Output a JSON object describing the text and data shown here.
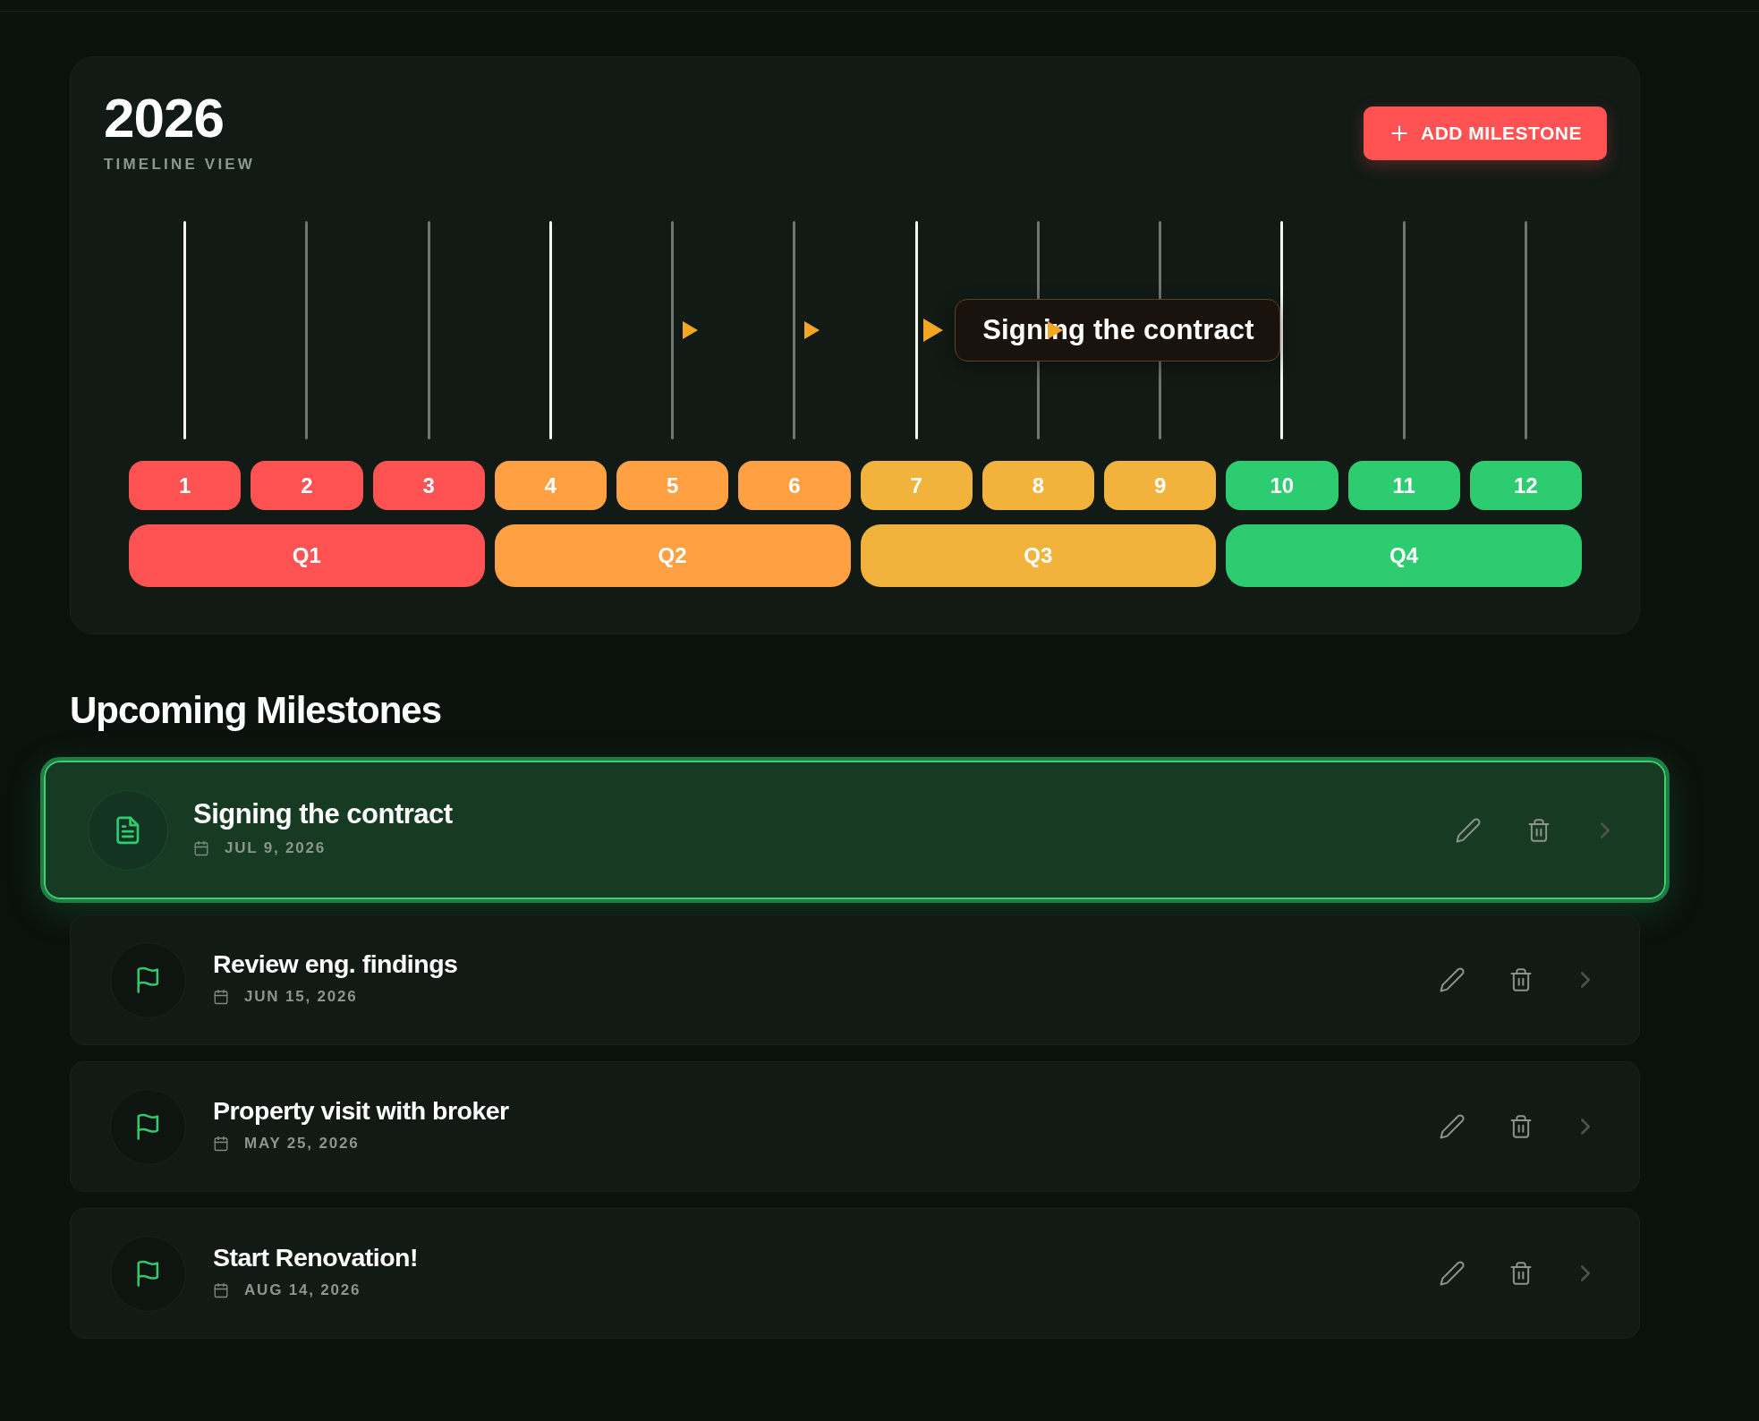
{
  "header": {
    "year": "2026",
    "subtitle": "TIMELINE VIEW",
    "add_button": {
      "label": "ADD MILESTONE"
    }
  },
  "timeline": {
    "quarters": [
      {
        "label": "Q1",
        "color": "#ff5252",
        "months": [
          {
            "label": "1"
          },
          {
            "label": "2"
          },
          {
            "label": "3"
          }
        ]
      },
      {
        "label": "Q2",
        "color": "#ffa142",
        "months": [
          {
            "label": "4"
          },
          {
            "label": "5",
            "markers": [
              {
                "selected": false
              }
            ]
          },
          {
            "label": "6",
            "markers": [
              {
                "selected": false
              }
            ]
          }
        ]
      },
      {
        "label": "Q3",
        "color": "#f2b33c",
        "months": [
          {
            "label": "7",
            "markers": [
              {
                "selected": true,
                "tooltip": "Signing the contract"
              }
            ]
          },
          {
            "label": "8",
            "markers": [
              {
                "selected": false
              }
            ]
          },
          {
            "label": "9"
          }
        ]
      },
      {
        "label": "Q4",
        "color": "#2ecc71",
        "months": [
          {
            "label": "10"
          },
          {
            "label": "11"
          },
          {
            "label": "12"
          }
        ]
      }
    ]
  },
  "milestones": {
    "title": "Upcoming Milestones",
    "items": [
      {
        "kind": "document",
        "title": "Signing the contract",
        "date": "JUL 9, 2026",
        "selected": true
      },
      {
        "kind": "flag",
        "title": "Review eng. findings",
        "date": "JUN 15, 2026",
        "selected": false
      },
      {
        "kind": "flag",
        "title": "Property visit with broker",
        "date": "MAY 25, 2026",
        "selected": false
      },
      {
        "kind": "flag",
        "title": "Start Renovation!",
        "date": "AUG 14, 2026",
        "selected": false
      }
    ]
  }
}
